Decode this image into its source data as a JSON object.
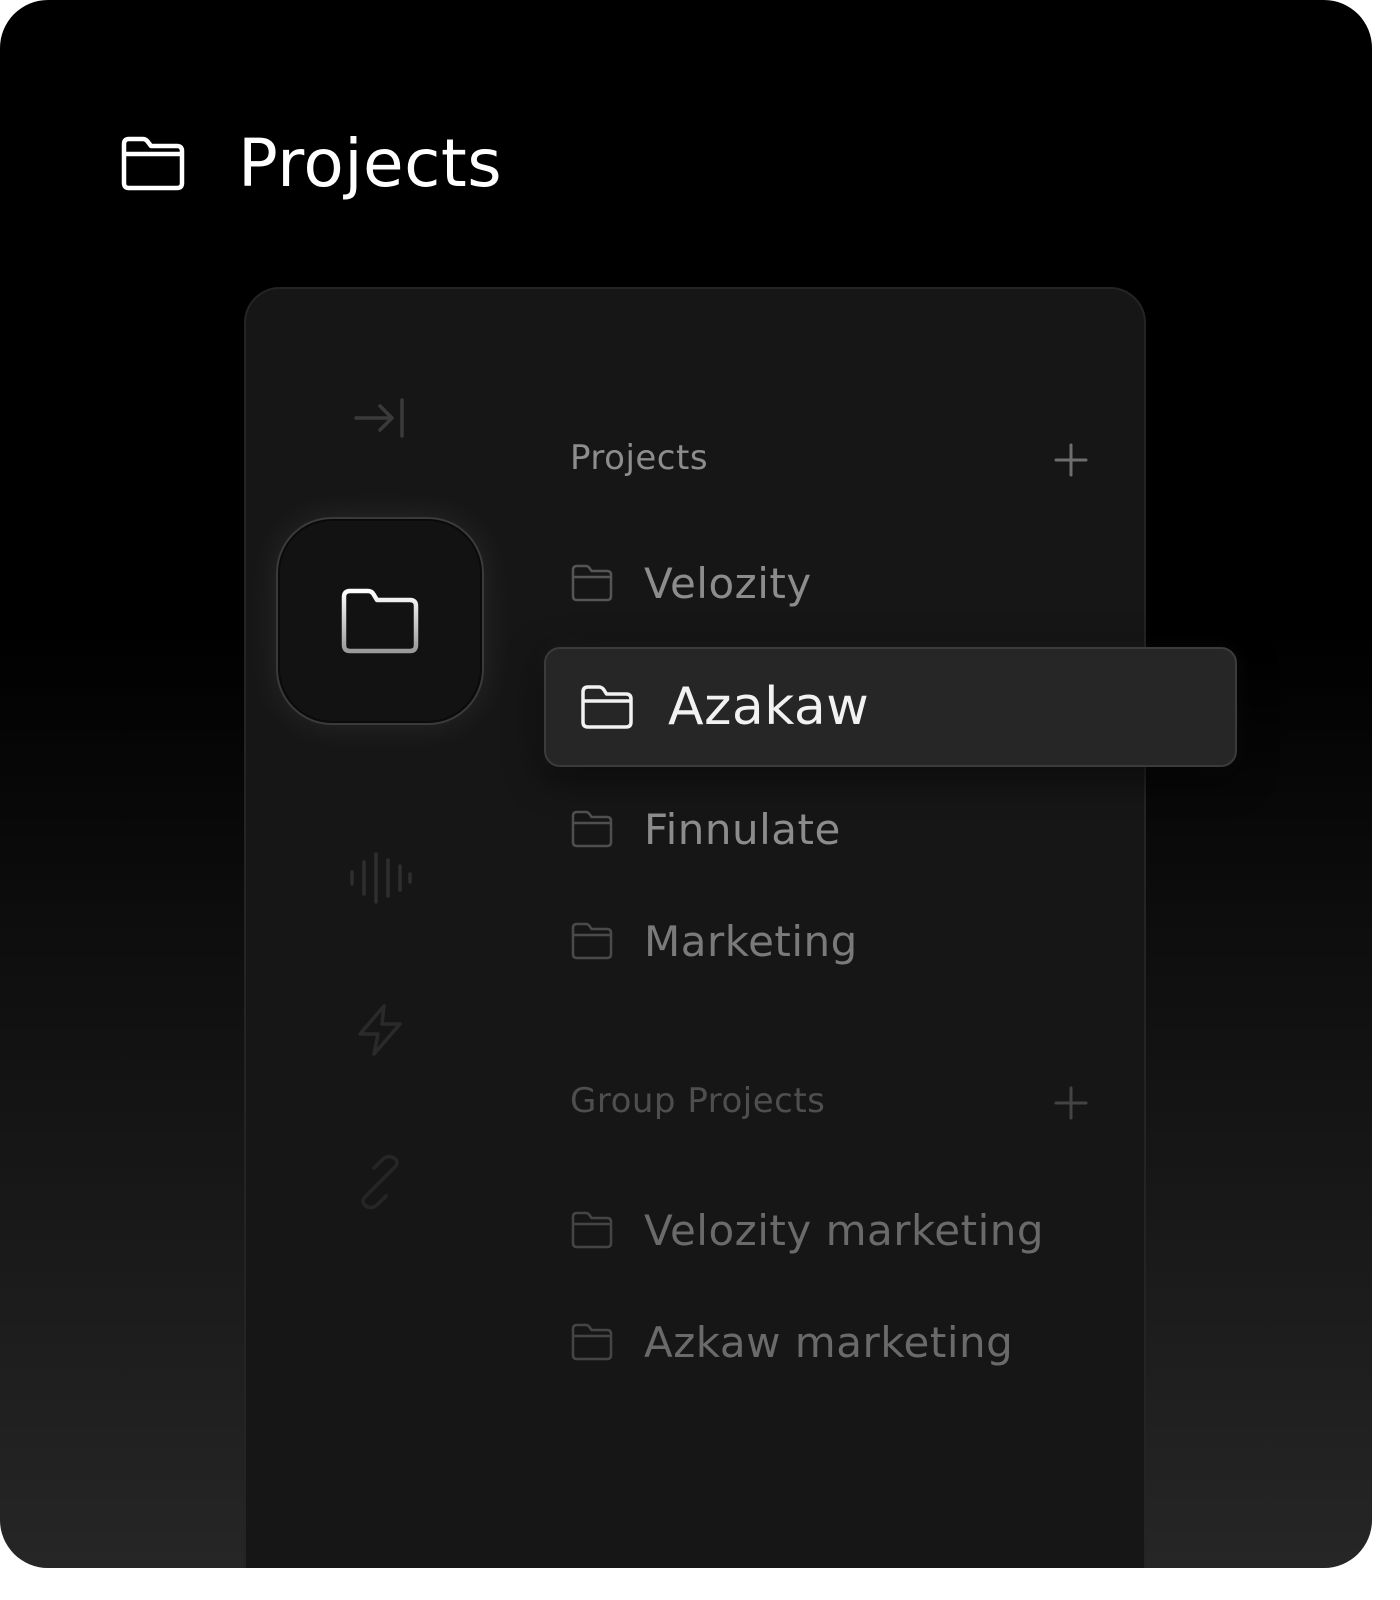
{
  "header": {
    "title": "Projects",
    "icon": "folder-icon"
  },
  "sidebar_rail": {
    "icons": [
      "collapse-sidebar-icon",
      "folder-icon",
      "waveform-icon",
      "lightning-icon",
      "link-icon"
    ],
    "active": "folder-icon"
  },
  "projects": {
    "title": "Projects",
    "add_icon": "plus-icon",
    "items": [
      {
        "label": "Velozity"
      },
      {
        "label": "Azakaw",
        "selected": true
      },
      {
        "label": "Finnulate"
      },
      {
        "label": "Marketing"
      }
    ]
  },
  "group_projects": {
    "title": "Group Projects",
    "add_icon": "plus-icon",
    "items": [
      {
        "label": "Velozity marketing"
      },
      {
        "label": "Azkaw marketing"
      }
    ]
  },
  "colors": {
    "background_top": "#000000",
    "panel": "#161616",
    "selected_row": "#262626",
    "text_primary": "#ffffff",
    "text_muted": "#8d8d8d"
  }
}
